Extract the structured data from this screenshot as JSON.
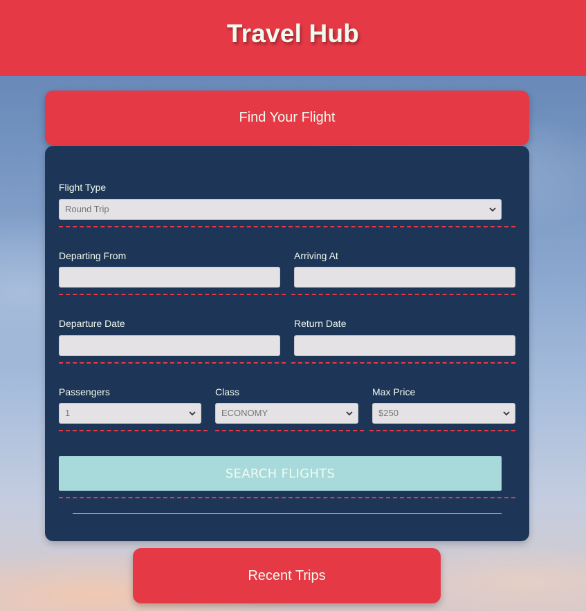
{
  "header": {
    "title": "Travel Hub"
  },
  "find_card": {
    "title": "Find Your Flight"
  },
  "form": {
    "flight_type": {
      "label": "Flight Type",
      "value": "Round Trip"
    },
    "departing_from": {
      "label": "Departing From",
      "value": ""
    },
    "arriving_at": {
      "label": "Arriving At",
      "value": ""
    },
    "departure_date": {
      "label": "Departure Date",
      "value": ""
    },
    "return_date": {
      "label": "Return Date",
      "value": ""
    },
    "passengers": {
      "label": "Passengers",
      "value": "1"
    },
    "class": {
      "label": "Class",
      "value": "ECONOMY"
    },
    "max_price": {
      "label": "Max Price",
      "value": "$250"
    },
    "search_button": {
      "label": "SEARCH FLIGHTS"
    }
  },
  "recent_card": {
    "title": "Recent Trips"
  },
  "icons": {
    "select_arrow": "chevron-down-icon"
  },
  "colors": {
    "accent_red": "#e63946",
    "panel_navy": "#1d3557",
    "button_aqua": "#a8dadc",
    "text_light": "#f1faee"
  }
}
